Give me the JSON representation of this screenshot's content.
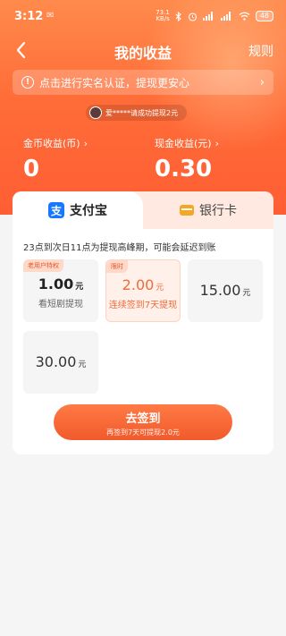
{
  "status_bar": {
    "time": "3:12",
    "notification": "✉",
    "net_speed_value": "73.1",
    "net_speed_unit": "KB/s",
    "battery": "48"
  },
  "nav": {
    "title": "我的收益",
    "rules": "规则"
  },
  "notice": {
    "text": "点击进行实名认证，提现更安心"
  },
  "ticker": {
    "text": "爱*****请成功提现2元"
  },
  "balances": {
    "coin_label": "金币收益(币)",
    "coin_value": "0",
    "cash_label": "现金收益(元)",
    "cash_value": "0.30"
  },
  "tabs": {
    "alipay": "支付宝",
    "alipay_icon_glyph": "支",
    "bank": "银行卡"
  },
  "peak_notice": "23点到次日11点为提现高峰期，可能会延迟到账",
  "options": [
    {
      "badge": "老用户特权",
      "amount": "1.00",
      "unit": "元",
      "sub": "看短剧提现"
    },
    {
      "badge": "限时",
      "amount": "2.00",
      "unit": "元",
      "sub": "连续签到7天提现"
    },
    {
      "amount": "15.00",
      "unit": "元"
    },
    {
      "amount": "30.00",
      "unit": "元"
    }
  ],
  "cta": {
    "label": "去签到",
    "hint": "再签到7天可提现2.0元"
  },
  "colors": {
    "accent": "#ff6d38",
    "alipay": "#1677ff",
    "highlight": "#f06a3a"
  },
  "icons": [
    "back-arrow-icon",
    "info-icon",
    "chevron-right-icon",
    "alipay-icon",
    "bank-card-icon",
    "wifi-icon",
    "bluetooth-icon",
    "signal-icon",
    "battery-icon"
  ]
}
